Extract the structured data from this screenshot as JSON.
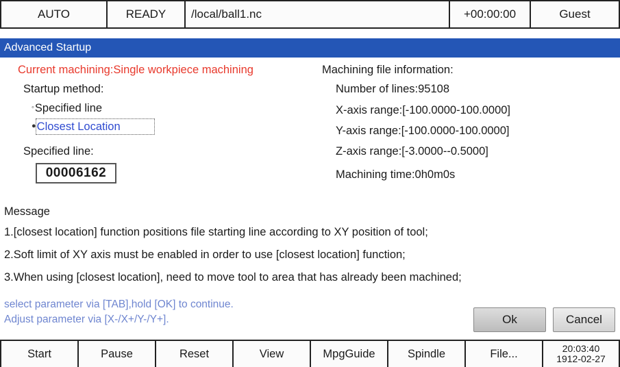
{
  "status_bar": {
    "mode": "AUTO",
    "state": "READY",
    "file_path": "/local/ball1.nc",
    "timer": "+00:00:00",
    "user": "Guest"
  },
  "dialog": {
    "title": "Advanced Startup",
    "current_machining": "Current machining:Single workpiece machining",
    "startup_method_label": "Startup method:",
    "options": [
      {
        "label": "Specified line",
        "selected": false
      },
      {
        "label": "Closest Location",
        "selected": true
      }
    ],
    "specified_line_label": "Specified line:",
    "specified_line_value": "00006162",
    "file_info": {
      "heading": "Machining file information:",
      "lines": "Number of lines:95108",
      "x_range": "X-axis range:[-100.0000-100.0000]",
      "y_range": "Y-axis range:[-100.0000-100.0000]",
      "z_range": "Z-axis range:[-3.0000--0.5000]",
      "time": "Machining time:0h0m0s"
    },
    "message": {
      "heading": "Message",
      "lines": [
        "1.[closest location] function positions file starting line according to XY position of tool;",
        "2.Soft limit of XY axis must be enabled in order to use [closest location] function;",
        "3.When using [closest location], need to move tool to area that has already been machined;"
      ]
    },
    "hints": [
      "select parameter via [TAB],hold [OK] to continue.",
      "Adjust parameter via [X-/X+/Y-/Y+]."
    ],
    "ok_label": "Ok",
    "cancel_label": "Cancel"
  },
  "softkeys": [
    "Start",
    "Pause",
    "Reset",
    "View",
    "MpgGuide",
    "Spindle",
    "File..."
  ],
  "clock": {
    "time": "20:03:40",
    "date": "1912-02-27"
  },
  "colors": {
    "title_bar": "#2456b6",
    "accent_red": "#e8392c",
    "hint_blue": "#6f86d0"
  }
}
